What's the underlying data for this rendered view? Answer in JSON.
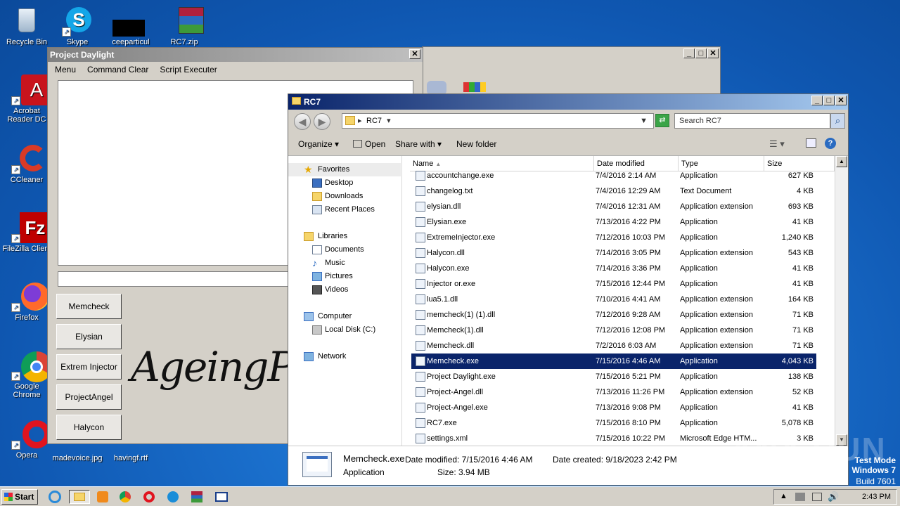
{
  "desktop": {
    "icons": [
      {
        "label": "Recycle Bin"
      },
      {
        "label": "Skype"
      },
      {
        "label": "ceeparticul"
      },
      {
        "label": "RC7.zip"
      },
      {
        "label": "Acrobat Reader DC"
      },
      {
        "label": "CCleaner"
      },
      {
        "label": "FileZilla Client"
      },
      {
        "label": "Firefox"
      },
      {
        "label": "Google Chrome"
      },
      {
        "label": "Opera"
      },
      {
        "label": "madevoice.jpg"
      },
      {
        "label": "havingf.rtf"
      }
    ]
  },
  "project_daylight": {
    "title": "Project Daylight",
    "menu": [
      "Menu",
      "Command Clear",
      "Script Executer"
    ],
    "buttons": [
      "Memcheck",
      "Elysian",
      "Extrem Injector",
      "ProjectAngel",
      "Halycon"
    ],
    "signature": "AgeingPu"
  },
  "explorer": {
    "title": "RC7",
    "address": "RC7",
    "search_placeholder": "Search RC7",
    "commands": {
      "organize": "Organize",
      "open": "Open",
      "share": "Share with",
      "new_folder": "New folder"
    },
    "nav": {
      "favorites": "Favorites",
      "desktop": "Desktop",
      "downloads": "Downloads",
      "recent": "Recent Places",
      "libraries": "Libraries",
      "documents": "Documents",
      "music": "Music",
      "pictures": "Pictures",
      "videos": "Videos",
      "computer": "Computer",
      "local_disk": "Local Disk (C:)",
      "network": "Network"
    },
    "columns": {
      "name": "Name",
      "date": "Date modified",
      "type": "Type",
      "size": "Size"
    },
    "files": [
      {
        "name": "accountchange.exe",
        "date": "7/4/2016 2:14 AM",
        "type": "Application",
        "size": "627 KB"
      },
      {
        "name": "changelog.txt",
        "date": "7/4/2016 12:29 AM",
        "type": "Text Document",
        "size": "4 KB"
      },
      {
        "name": "elysian.dll",
        "date": "7/4/2016 12:31 AM",
        "type": "Application extension",
        "size": "693 KB"
      },
      {
        "name": "Elysian.exe",
        "date": "7/13/2016 4:22 PM",
        "type": "Application",
        "size": "41 KB"
      },
      {
        "name": "ExtremeInjector.exe",
        "date": "7/12/2016 10:03 PM",
        "type": "Application",
        "size": "1,240 KB"
      },
      {
        "name": "Halycon.dll",
        "date": "7/14/2016 3:05 PM",
        "type": "Application extension",
        "size": "543 KB"
      },
      {
        "name": "Halycon.exe",
        "date": "7/14/2016 3:36 PM",
        "type": "Application",
        "size": "41 KB"
      },
      {
        "name": "Injector or.exe",
        "date": "7/15/2016 12:44 PM",
        "type": "Application",
        "size": "41 KB"
      },
      {
        "name": "lua5.1.dll",
        "date": "7/10/2016 4:41 AM",
        "type": "Application extension",
        "size": "164 KB"
      },
      {
        "name": "memcheck(1) (1).dll",
        "date": "7/12/2016 9:28 AM",
        "type": "Application extension",
        "size": "71 KB"
      },
      {
        "name": "Memcheck(1).dll",
        "date": "7/12/2016 12:08 PM",
        "type": "Application extension",
        "size": "71 KB"
      },
      {
        "name": "Memcheck.dll",
        "date": "7/2/2016 6:03 AM",
        "type": "Application extension",
        "size": "71 KB"
      },
      {
        "name": "Memcheck.exe",
        "date": "7/15/2016 4:46 AM",
        "type": "Application",
        "size": "4,043 KB"
      },
      {
        "name": "Project Daylight.exe",
        "date": "7/15/2016 5:21 PM",
        "type": "Application",
        "size": "138 KB"
      },
      {
        "name": "Project-Angel.dll",
        "date": "7/13/2016 11:26 PM",
        "type": "Application extension",
        "size": "52 KB"
      },
      {
        "name": "Project-Angel.exe",
        "date": "7/13/2016 9:08 PM",
        "type": "Application",
        "size": "41 KB"
      },
      {
        "name": "RC7.exe",
        "date": "7/15/2016 8:10 PM",
        "type": "Application",
        "size": "5,078 KB"
      },
      {
        "name": "settings.xml",
        "date": "7/15/2016 10:22 PM",
        "type": "Microsoft Edge HTM...",
        "size": "3 KB"
      }
    ],
    "details": {
      "filename": "Memcheck.exe",
      "type": "Application",
      "modified": "Date modified: 7/15/2016 4:46 AM",
      "size": "Size: 3.94 MB",
      "created": "Date created: 9/18/2023 2:42 PM"
    }
  },
  "taskbar": {
    "start": "Start",
    "clock": "2:43 PM"
  },
  "watermark": {
    "mode": "Test Mode",
    "os": "Windows 7",
    "build": "Build 7601",
    "anyrun": "ANY RUN"
  }
}
